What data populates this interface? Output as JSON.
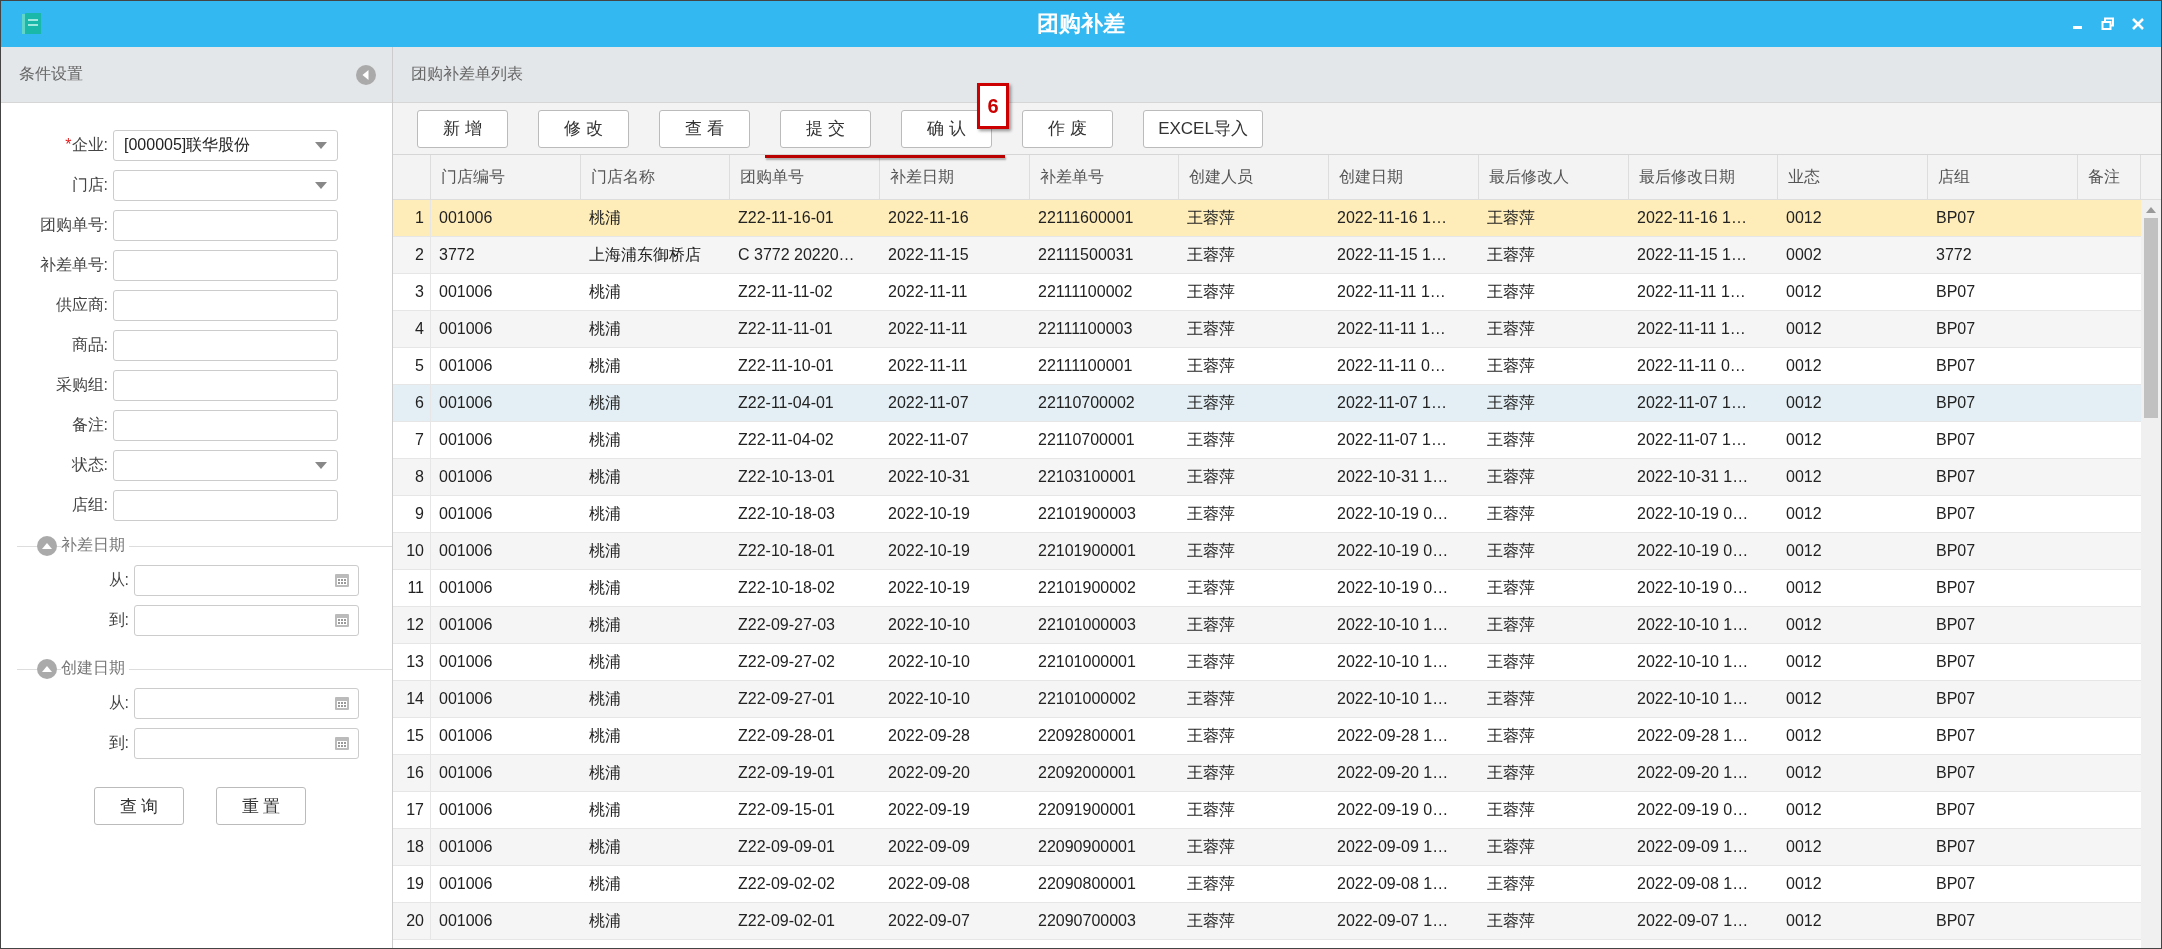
{
  "window": {
    "title": "团购补差"
  },
  "sidebar": {
    "title": "条件设置",
    "fields": [
      {
        "label": "企业:",
        "required_mark": "*",
        "kind": "select",
        "value": "[000005]联华股份"
      },
      {
        "label": "门店:",
        "kind": "select"
      },
      {
        "label": "团购单号:",
        "kind": "text"
      },
      {
        "label": "补差单号:",
        "kind": "text"
      },
      {
        "label": "供应商:",
        "kind": "text"
      },
      {
        "label": "商品:",
        "kind": "text"
      },
      {
        "label": "采购组:",
        "kind": "text"
      },
      {
        "label": "备注:",
        "kind": "text"
      },
      {
        "label": "状态:",
        "kind": "select"
      },
      {
        "label": "店组:",
        "kind": "text"
      }
    ],
    "date_groups": [
      {
        "title": "补差日期",
        "expanded": true,
        "fields": [
          {
            "label": "从:"
          },
          {
            "label": "到:"
          }
        ]
      },
      {
        "title": "创建日期",
        "expanded": true,
        "fields": [
          {
            "label": "从:"
          },
          {
            "label": "到:"
          }
        ]
      }
    ],
    "buttons": [
      "查 询",
      "重 置"
    ]
  },
  "list": {
    "title": "团购补差单列表",
    "toolbar": [
      "新 增",
      "修 改",
      "查 看",
      "提 交",
      "确 认",
      "作 废",
      "EXCEL导入"
    ],
    "annotation": {
      "label": "6"
    },
    "table": {
      "columns": [
        "",
        "门店编号",
        "门店名称",
        "团购单号",
        "补差日期",
        "补差单号",
        "创建人员",
        "创建日期",
        "最后修改人",
        "最后修改日期",
        "业态",
        "店组",
        "备注"
      ],
      "rows": [
        {
          "cells": [
            "1",
            "001006",
            "桃浦",
            "Z22-11-16-01",
            "2022-11-16",
            "22111600001",
            "王蓉萍",
            "2022-11-16 1…",
            "王蓉萍",
            "2022-11-16 1…",
            "0012",
            "BP07"
          ],
          "selected": true,
          "highlighted": false
        },
        {
          "cells": [
            "2",
            "3772",
            "上海浦东御桥店",
            "C 3772 20220…",
            "2022-11-15",
            "22111500031",
            "王蓉萍",
            "2022-11-15 1…",
            "王蓉萍",
            "2022-11-15 1…",
            "0002",
            "3772"
          ],
          "selected": false,
          "highlighted": false
        },
        {
          "cells": [
            "3",
            "001006",
            "桃浦",
            "Z22-11-11-02",
            "2022-11-11",
            "22111100002",
            "王蓉萍",
            "2022-11-11 1…",
            "王蓉萍",
            "2022-11-11 1…",
            "0012",
            "BP07"
          ],
          "selected": false,
          "highlighted": false
        },
        {
          "cells": [
            "4",
            "001006",
            "桃浦",
            "Z22-11-11-01",
            "2022-11-11",
            "22111100003",
            "王蓉萍",
            "2022-11-11 1…",
            "王蓉萍",
            "2022-11-11 1…",
            "0012",
            "BP07"
          ],
          "selected": false,
          "highlighted": false
        },
        {
          "cells": [
            "5",
            "001006",
            "桃浦",
            "Z22-11-10-01",
            "2022-11-11",
            "22111100001",
            "王蓉萍",
            "2022-11-11 0…",
            "王蓉萍",
            "2022-11-11 0…",
            "0012",
            "BP07"
          ],
          "selected": false,
          "highlighted": false
        },
        {
          "cells": [
            "6",
            "001006",
            "桃浦",
            "Z22-11-04-01",
            "2022-11-07",
            "22110700002",
            "王蓉萍",
            "2022-11-07 1…",
            "王蓉萍",
            "2022-11-07 1…",
            "0012",
            "BP07"
          ],
          "selected": false,
          "highlighted": true
        },
        {
          "cells": [
            "7",
            "001006",
            "桃浦",
            "Z22-11-04-02",
            "2022-11-07",
            "22110700001",
            "王蓉萍",
            "2022-11-07 1…",
            "王蓉萍",
            "2022-11-07 1…",
            "0012",
            "BP07"
          ],
          "selected": false,
          "highlighted": false
        },
        {
          "cells": [
            "8",
            "001006",
            "桃浦",
            "Z22-10-13-01",
            "2022-10-31",
            "22103100001",
            "王蓉萍",
            "2022-10-31 1…",
            "王蓉萍",
            "2022-10-31 1…",
            "0012",
            "BP07"
          ],
          "selected": false,
          "highlighted": false
        },
        {
          "cells": [
            "9",
            "001006",
            "桃浦",
            "Z22-10-18-03",
            "2022-10-19",
            "22101900003",
            "王蓉萍",
            "2022-10-19 0…",
            "王蓉萍",
            "2022-10-19 0…",
            "0012",
            "BP07"
          ],
          "selected": false,
          "highlighted": false
        },
        {
          "cells": [
            "10",
            "001006",
            "桃浦",
            "Z22-10-18-01",
            "2022-10-19",
            "22101900001",
            "王蓉萍",
            "2022-10-19 0…",
            "王蓉萍",
            "2022-10-19 0…",
            "0012",
            "BP07"
          ],
          "selected": false,
          "highlighted": false
        },
        {
          "cells": [
            "11",
            "001006",
            "桃浦",
            "Z22-10-18-02",
            "2022-10-19",
            "22101900002",
            "王蓉萍",
            "2022-10-19 0…",
            "王蓉萍",
            "2022-10-19 0…",
            "0012",
            "BP07"
          ],
          "selected": false,
          "highlighted": false
        },
        {
          "cells": [
            "12",
            "001006",
            "桃浦",
            "Z22-09-27-03",
            "2022-10-10",
            "22101000003",
            "王蓉萍",
            "2022-10-10 1…",
            "王蓉萍",
            "2022-10-10 1…",
            "0012",
            "BP07"
          ],
          "selected": false,
          "highlighted": false
        },
        {
          "cells": [
            "13",
            "001006",
            "桃浦",
            "Z22-09-27-02",
            "2022-10-10",
            "22101000001",
            "王蓉萍",
            "2022-10-10 1…",
            "王蓉萍",
            "2022-10-10 1…",
            "0012",
            "BP07"
          ],
          "selected": false,
          "highlighted": false
        },
        {
          "cells": [
            "14",
            "001006",
            "桃浦",
            "Z22-09-27-01",
            "2022-10-10",
            "22101000002",
            "王蓉萍",
            "2022-10-10 1…",
            "王蓉萍",
            "2022-10-10 1…",
            "0012",
            "BP07"
          ],
          "selected": false,
          "highlighted": false
        },
        {
          "cells": [
            "15",
            "001006",
            "桃浦",
            "Z22-09-28-01",
            "2022-09-28",
            "22092800001",
            "王蓉萍",
            "2022-09-28 1…",
            "王蓉萍",
            "2022-09-28 1…",
            "0012",
            "BP07"
          ],
          "selected": false,
          "highlighted": false
        },
        {
          "cells": [
            "16",
            "001006",
            "桃浦",
            "Z22-09-19-01",
            "2022-09-20",
            "22092000001",
            "王蓉萍",
            "2022-09-20 1…",
            "王蓉萍",
            "2022-09-20 1…",
            "0012",
            "BP07"
          ],
          "selected": false,
          "highlighted": false
        },
        {
          "cells": [
            "17",
            "001006",
            "桃浦",
            "Z22-09-15-01",
            "2022-09-19",
            "22091900001",
            "王蓉萍",
            "2022-09-19 0…",
            "王蓉萍",
            "2022-09-19 0…",
            "0012",
            "BP07"
          ],
          "selected": false,
          "highlighted": false
        },
        {
          "cells": [
            "18",
            "001006",
            "桃浦",
            "Z22-09-09-01",
            "2022-09-09",
            "22090900001",
            "王蓉萍",
            "2022-09-09 1…",
            "王蓉萍",
            "2022-09-09 1…",
            "0012",
            "BP07"
          ],
          "selected": false,
          "highlighted": false
        },
        {
          "cells": [
            "19",
            "001006",
            "桃浦",
            "Z22-09-02-02",
            "2022-09-08",
            "22090800001",
            "王蓉萍",
            "2022-09-08 1…",
            "王蓉萍",
            "2022-09-08 1…",
            "0012",
            "BP07"
          ],
          "selected": false,
          "highlighted": false
        },
        {
          "cells": [
            "20",
            "001006",
            "桃浦",
            "Z22-09-02-01",
            "2022-09-07",
            "22090700003",
            "王蓉萍",
            "2022-09-07 1…",
            "王蓉萍",
            "2022-09-07 1…",
            "0012",
            "BP07"
          ],
          "selected": false,
          "highlighted": false
        }
      ]
    }
  }
}
